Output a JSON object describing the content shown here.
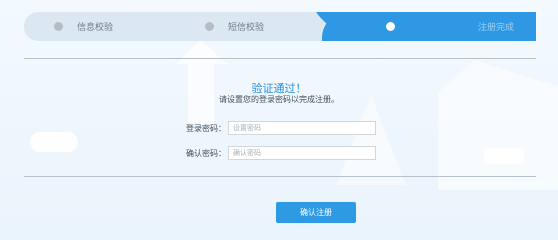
{
  "steps": [
    {
      "label": "信息校验",
      "status": "done"
    },
    {
      "label": "短信校验",
      "status": "done"
    },
    {
      "label": "注册完成",
      "status": "active"
    }
  ],
  "result": {
    "title": "验证通过！",
    "subtitle": "请设置您的登录密码以完成注册。"
  },
  "form": {
    "login_password": {
      "label": "登录密码：",
      "placeholder": "设置密码",
      "value": ""
    },
    "confirm_password": {
      "label": "确认密码：",
      "placeholder": "确认密码",
      "value": ""
    }
  },
  "buttons": {
    "confirm_register": "确认注册"
  },
  "colors": {
    "accent": "#2f98e4",
    "step_bar": "#dbe8f2",
    "title": "#2a8ddc"
  }
}
